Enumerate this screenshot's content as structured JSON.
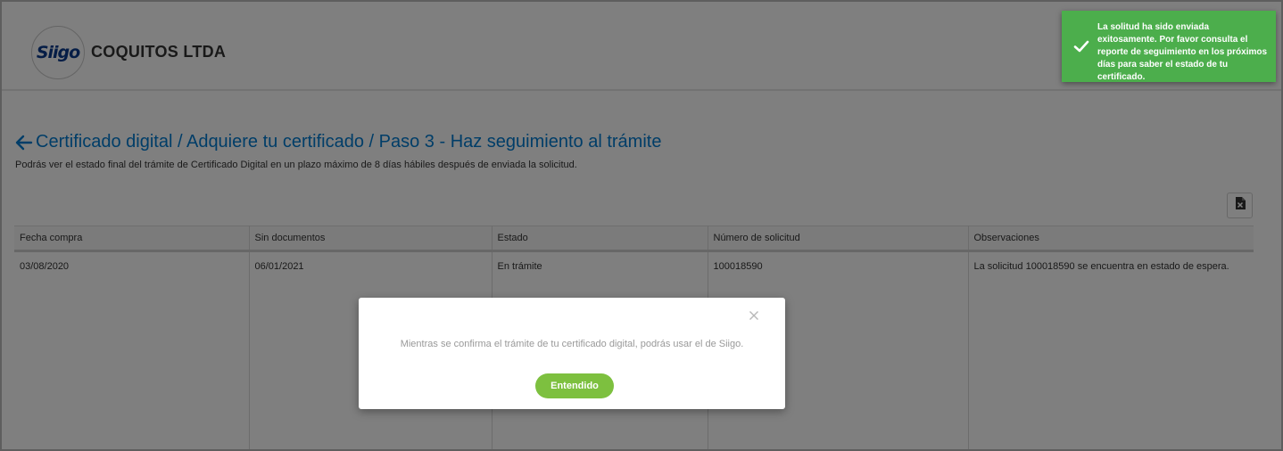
{
  "header": {
    "logo_text": "Siigo",
    "company_name": "COQUITOS LTDA"
  },
  "page": {
    "breadcrumb": "Certificado digital / Adquiere tu certificado / Paso 3 - Haz seguimiento al trámite",
    "subtitle": "Podrás ver el estado final del trámite de Certificado Digital en un plazo máximo de 8 días hábiles después de enviada la solicitud."
  },
  "table": {
    "columns": [
      "Fecha compra",
      "Sin documentos",
      "Estado",
      "Número de solicitud",
      "Observaciones"
    ],
    "rows": [
      [
        "03/08/2020",
        "06/01/2021",
        "En trámite",
        "100018590",
        "La solicitud 100018590 se encuentra en estado de espera."
      ]
    ]
  },
  "toast": {
    "message": "La solitud ha sido enviada exitosamente. Por favor consulta el reporte de seguimiento en los próximos días para saber el estado de tu certificado."
  },
  "modal": {
    "message": "Mientras se confirma el trámite de tu certificado digital, podrás usar el de Siigo.",
    "button_label": "Entendido"
  },
  "colors": {
    "link_blue": "#007bd0",
    "toast_green": "#4cae4c",
    "button_green": "#7dc03f"
  },
  "icons": [
    "back-arrow-icon",
    "excel-export-icon",
    "check-icon",
    "close-icon"
  ]
}
